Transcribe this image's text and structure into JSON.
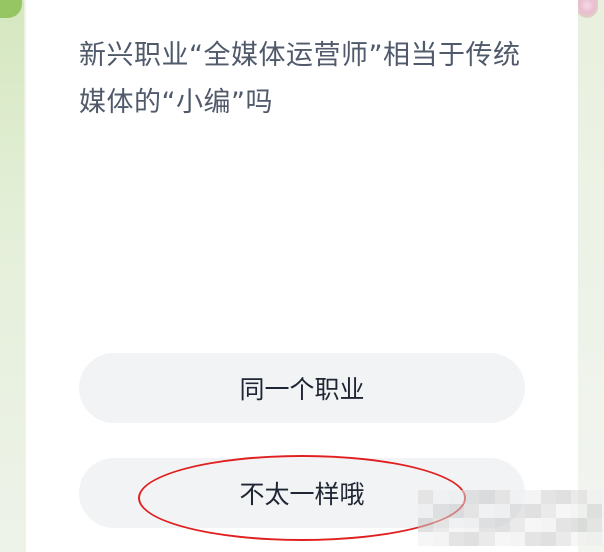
{
  "quiz": {
    "question": "新兴职业“全媒体运营师”相当于传统媒体的“小编”吗",
    "options": [
      {
        "label": "同一个职业"
      },
      {
        "label": "不太一样哦"
      }
    ]
  },
  "colors": {
    "question_text": "#505a6b",
    "option_bg": "#f2f3f5",
    "option_text": "#1f2633",
    "annotation": "#e02020"
  }
}
